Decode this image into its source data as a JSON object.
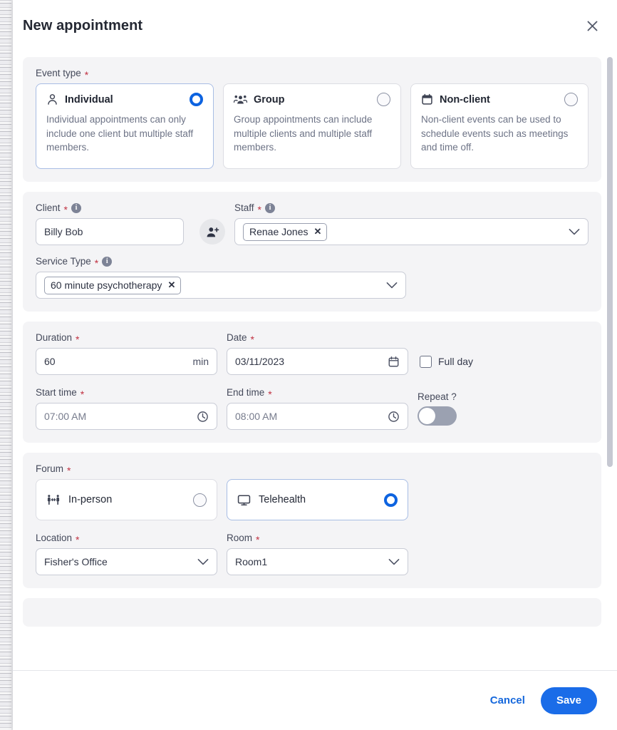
{
  "modal": {
    "title": "New appointment",
    "close_icon": "close-icon"
  },
  "event_type": {
    "label": "Event type",
    "required_mark": "*",
    "options": [
      {
        "name": "Individual",
        "description": "Individual appointments can only include one client but multiple staff members.",
        "icon": "person-icon",
        "selected": true
      },
      {
        "name": "Group",
        "description": "Group appointments can include multiple clients and multiple staff members.",
        "icon": "people-group-icon",
        "selected": false
      },
      {
        "name": "Non-client",
        "description": "Non-client events can be used to schedule events such as meetings and time off.",
        "icon": "calendar-icon",
        "selected": false
      }
    ]
  },
  "client": {
    "label": "Client",
    "required_mark": "*",
    "info_icon": "info-icon",
    "value": "Billy Bob",
    "add_icon": "add-person-icon"
  },
  "staff": {
    "label": "Staff",
    "required_mark": "*",
    "info_icon": "info-icon",
    "tokens": [
      "Renae Jones"
    ],
    "remove_icon": "remove-token-icon",
    "chevron_icon": "chevron-down-icon"
  },
  "service_type": {
    "label": "Service Type",
    "required_mark": "*",
    "info_icon": "info-icon",
    "tokens": [
      "60 minute psychotherapy"
    ],
    "remove_icon": "remove-token-icon",
    "chevron_icon": "chevron-down-icon"
  },
  "duration": {
    "label": "Duration",
    "required_mark": "*",
    "value": "60",
    "unit": "min"
  },
  "date": {
    "label": "Date",
    "required_mark": "*",
    "value": "03/11/2023",
    "calendar_icon": "calendar-icon"
  },
  "full_day": {
    "label": "Full day",
    "checked": false
  },
  "start_time": {
    "label": "Start time",
    "required_mark": "*",
    "value": "07:00 AM",
    "clock_icon": "clock-icon"
  },
  "end_time": {
    "label": "End time",
    "required_mark": "*",
    "value": "08:00 AM",
    "clock_icon": "clock-icon"
  },
  "repeat": {
    "label": "Repeat ?",
    "on": false
  },
  "forum": {
    "label": "Forum",
    "required_mark": "*",
    "options": [
      {
        "name": "In-person",
        "icon": "in-person-icon",
        "selected": false
      },
      {
        "name": "Telehealth",
        "icon": "monitor-icon",
        "selected": true
      }
    ]
  },
  "location": {
    "label": "Location",
    "required_mark": "*",
    "value": "Fisher's Office",
    "chevron_icon": "chevron-down-icon"
  },
  "room": {
    "label": "Room",
    "required_mark": "*",
    "value": "Room1",
    "chevron_icon": "chevron-down-icon"
  },
  "footer": {
    "cancel_label": "Cancel",
    "save_label": "Save"
  },
  "colors": {
    "accent": "#1a6ce8",
    "link": "#1668dc",
    "required": "#c03040",
    "section_bg": "#f4f4f6",
    "text": "#242833"
  }
}
